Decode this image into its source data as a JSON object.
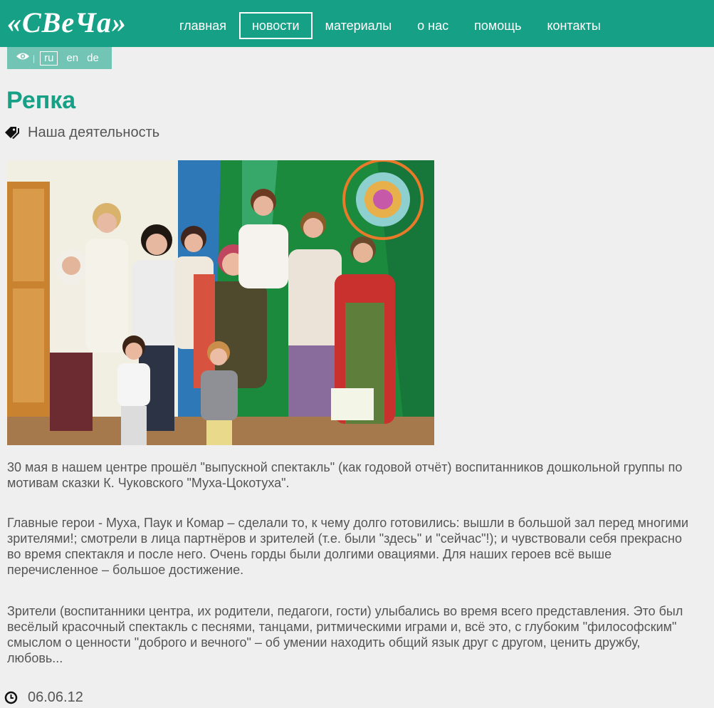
{
  "header": {
    "logo_text": "«СВеЧа»",
    "nav": [
      {
        "label": "главная",
        "active": false
      },
      {
        "label": "новости",
        "active": true
      },
      {
        "label": "материалы",
        "active": false
      },
      {
        "label": "о нас",
        "active": false
      },
      {
        "label": "помощь",
        "active": false
      },
      {
        "label": "контакты",
        "active": false
      }
    ],
    "accent_color": "#16a086"
  },
  "langbar": {
    "icon": "eye-icon",
    "separator": "|",
    "languages": [
      {
        "code": "ru",
        "active": true
      },
      {
        "code": "en",
        "active": false
      },
      {
        "code": "de",
        "active": false
      }
    ]
  },
  "article": {
    "title": "Репка",
    "category_icon": "tags-icon",
    "category": "Наша деятельность",
    "paragraphs": [
      "30 мая в нашем центре прошёл \"выпускной спектакль\" (как годовой отчёт) воспитанников дошкольной группы по мотивам сказки К. Чуковского \"Муха-Цокотуха\".",
      "Главные герои - Муха, Паук и Комар – сделали то, к чему долго готовились: вышли в большой зал перед многими зрителями!; смотрели в лица партнёров и зрителей (т.е. были \"здесь\" и \"сейчас\"!); и чувствовали себя прекрасно во время спектакля и после него. Очень горды были долгими овациями. Для наших героев всё выше перечисленное – большое достижение.",
      "Зрители (воспитанники центра, их родители, педагоги, гости) улыбались во время всего представления. Это был весёлый красочный спектакль с песнями, танцами, ритмическими играми и, всё это, с глубоким \"философским\" смыслом о ценности \"доброго и вечного\" – об умении находить общий язык друг с другом, ценить дружбу, любовь..."
    ],
    "date_icon": "clock-icon",
    "date": "06.06.12"
  }
}
